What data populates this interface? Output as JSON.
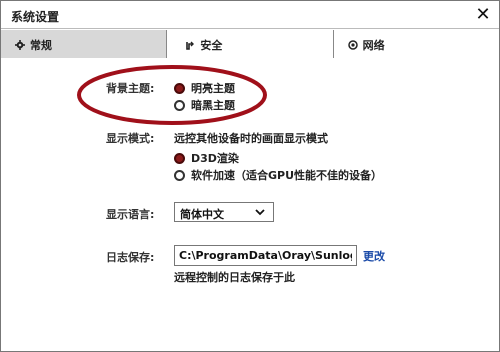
{
  "window": {
    "title": "系统设置"
  },
  "tabs": [
    {
      "label": "常规",
      "icon": "gear-icon",
      "active": true
    },
    {
      "label": "安全",
      "icon": "security-icon",
      "active": false
    },
    {
      "label": "网络",
      "icon": "network-icon",
      "active": false
    }
  ],
  "theme": {
    "label": "背景主题:",
    "options": [
      {
        "label": "明亮主题",
        "checked": true
      },
      {
        "label": "暗黑主题",
        "checked": false
      }
    ]
  },
  "display_mode": {
    "label": "显示模式:",
    "description": "远控其他设备时的画面显示模式",
    "options": [
      {
        "label": "D3D渲染",
        "checked": true
      },
      {
        "label": "软件加速（适合GPU性能不佳的设备）",
        "checked": false
      }
    ]
  },
  "language": {
    "label": "显示语言:",
    "selected": "简体中文"
  },
  "log": {
    "label": "日志保存:",
    "path": "C:\\ProgramData\\Oray\\SunloginClient",
    "change_label": "更改",
    "note": "远程控制的日志保存于此"
  },
  "colors": {
    "annotation": "#a0101a",
    "link": "#1a4aa8",
    "radio_checked": "#8b1a1a"
  }
}
